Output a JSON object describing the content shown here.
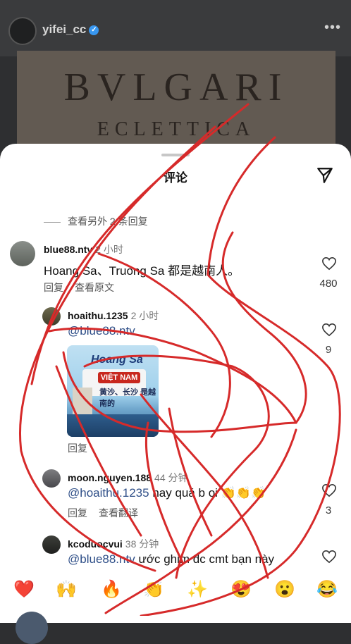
{
  "post": {
    "username": "yifei_cc",
    "brand": "BVLGARI",
    "collection": "ECLETTICA"
  },
  "sheet": {
    "title": "评论",
    "view_more_replies": "查看另外 2 条回复"
  },
  "comments": [
    {
      "user": "blue88.ntv",
      "time": "2 小时",
      "text": "Hoang Sa、Truong Sa 都是越南人。",
      "actions": [
        "回复",
        "查看原文"
      ],
      "likes": "480"
    },
    {
      "user": "hoaithu.1235",
      "time": "2 小时",
      "mention": "@blue88.ntv",
      "sticker_title": "Hoang Sa",
      "sticker_badge": "VIỆT NAM",
      "sticker_text": "黄沙、长沙 是越南的",
      "actions": [
        "回复"
      ],
      "likes": "9"
    },
    {
      "user": "moon.nguyen.188",
      "time": "44 分钟",
      "mention": "@hoaithu.1235",
      "text": "hay quá b oi 👏👏👏",
      "actions": [
        "回复",
        "查看翻译"
      ],
      "likes": "3"
    },
    {
      "user": "kcoduocvui",
      "time": "38 分钟",
      "mention": "@blue88.ntv",
      "text": "ước ghim dc cmt bạn này"
    }
  ],
  "reactions": [
    "❤️",
    "🙌",
    "🔥",
    "👏",
    "✨",
    "😍",
    "😮",
    "😂"
  ],
  "colors": {
    "overlay_scribble": "#d62a2a",
    "mention": "#2f4f88"
  }
}
